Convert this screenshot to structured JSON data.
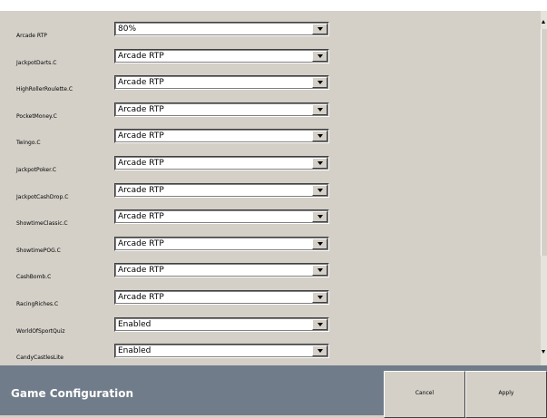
{
  "rows": [
    {
      "label": "Arcade RTP",
      "value": "80%"
    },
    {
      "label": "JackpotDarts.C",
      "value": "Arcade RTP"
    },
    {
      "label": "HighRollerRoulette.C",
      "value": "Arcade RTP"
    },
    {
      "label": "PocketMoney.C",
      "value": "Arcade RTP"
    },
    {
      "label": "Twingo.C",
      "value": "Arcade RTP"
    },
    {
      "label": "JackpotPoker.C",
      "value": "Arcade RTP"
    },
    {
      "label": "JackpotCashDrop.C",
      "value": "Arcade RTP"
    },
    {
      "label": "ShowtimeClassic.C",
      "value": "Arcade RTP"
    },
    {
      "label": "ShowtimePOG.C",
      "value": "Arcade RTP"
    },
    {
      "label": "CashBomb.C",
      "value": "Arcade RTP"
    },
    {
      "label": "RacingRiches.C",
      "value": "Arcade RTP"
    },
    {
      "label": "WorldOfSportQuiz",
      "value": "Enabled"
    },
    {
      "label": "CandyCastlesLite",
      "value": "Enabled"
    }
  ],
  "footer": {
    "title": "Game Configuration",
    "cancel_label": "Cancel",
    "apply_label": "Apply"
  },
  "icons": {
    "dropdown": "chevron-down-icon",
    "scroll_up": "arrow-up-icon",
    "scroll_down": "arrow-down-icon"
  },
  "colors": {
    "background": "#d4d0c8",
    "footer": "#707c89",
    "footer_text": "#ffffff"
  }
}
